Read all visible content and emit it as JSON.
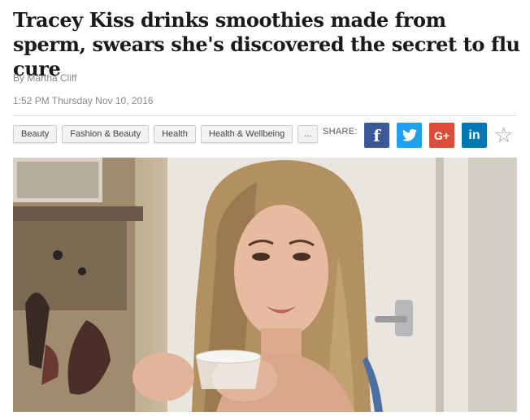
{
  "article": {
    "headline": "Tracey Kiss drinks smoothies made from sperm, swears she's discovered the secret to flu cure",
    "byline": "By Martha Cliff",
    "timestamp": "1:52 PM Thursday Nov 10, 2016"
  },
  "tags": [
    {
      "label": "Beauty"
    },
    {
      "label": "Fashion & Beauty"
    },
    {
      "label": "Health"
    },
    {
      "label": "Health & Wellbeing"
    },
    {
      "label": "..."
    }
  ],
  "share": {
    "label": "SHARE:",
    "buttons": [
      {
        "network": "facebook",
        "glyph": "f",
        "color": "#3b5998"
      },
      {
        "network": "twitter",
        "glyph": "bird-icon",
        "color": "#1da1f2"
      },
      {
        "network": "google-plus",
        "glyph": "G+",
        "color": "#dd4b39"
      },
      {
        "network": "linkedin",
        "glyph": "in",
        "color": "#0077b5"
      }
    ],
    "favorite_icon": "star-outline-icon"
  },
  "photo": {
    "subject": "woman with long blonde hair holding a small plastic cup"
  }
}
